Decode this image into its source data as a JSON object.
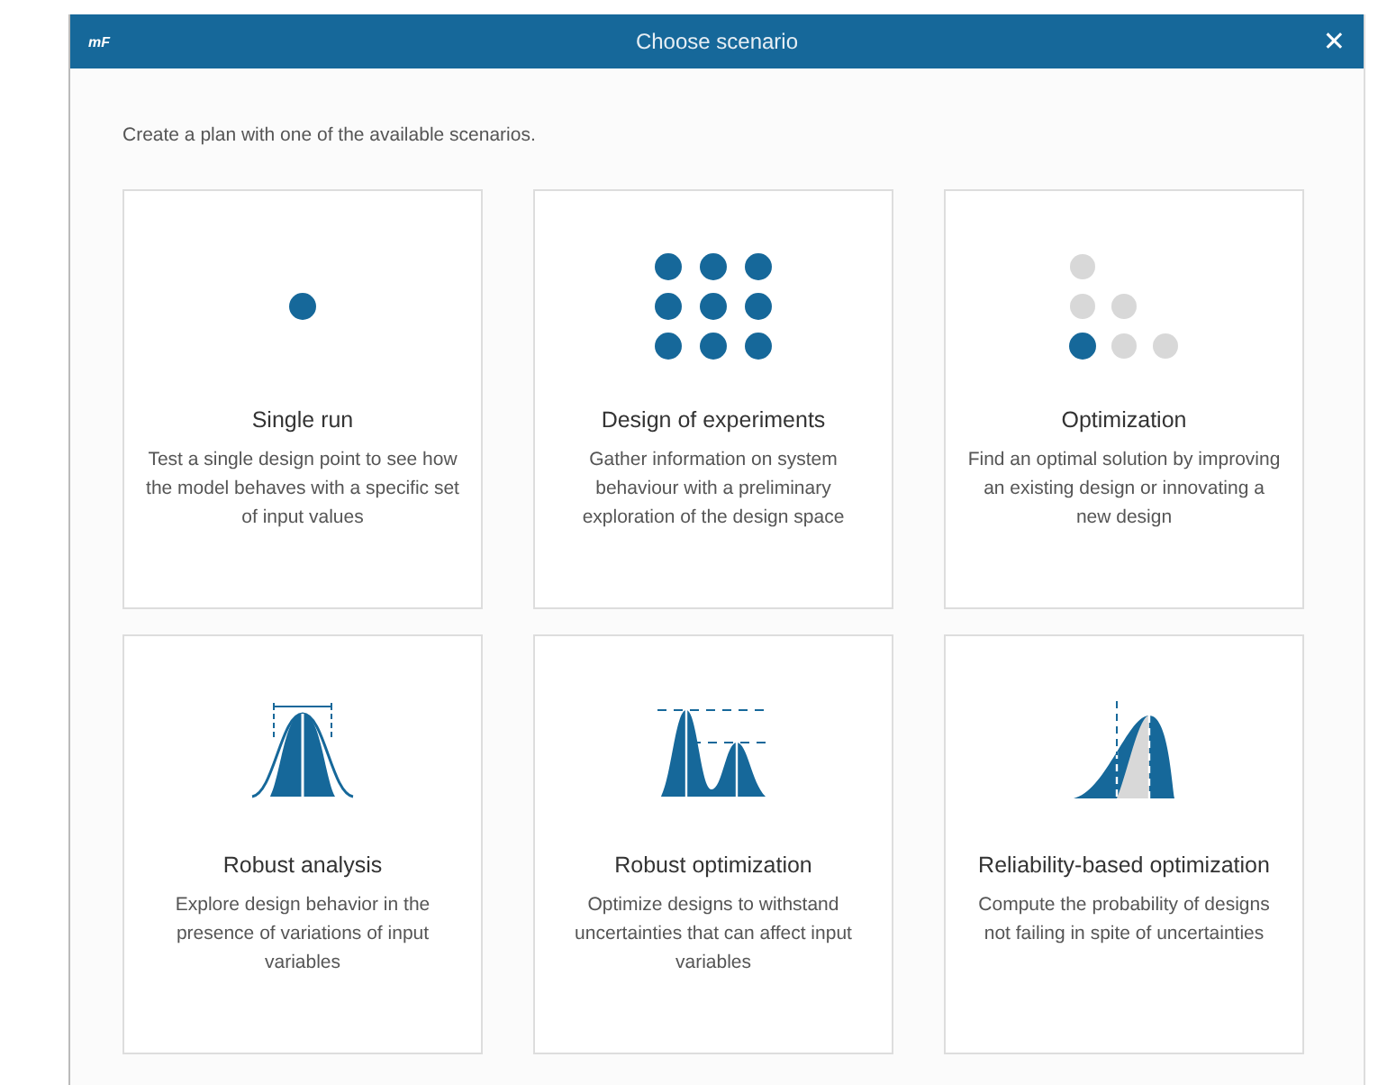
{
  "window": {
    "logo": "mF",
    "title": "Choose scenario",
    "close": "✕"
  },
  "intro": "Create a plan with one of the available scenarios.",
  "scenarios": [
    {
      "kind": "single",
      "title": "Single run",
      "description": "Test a single design point to see how the model behaves with a specific set of input values"
    },
    {
      "kind": "grid",
      "title": "Design of experiments",
      "description": "Gather information on system behaviour with a preliminary exploration of the design space"
    },
    {
      "kind": "optimization",
      "title": "Optimization",
      "description": "Find an optimal solution by improving an existing design or innovating a new design"
    },
    {
      "kind": "robust-analysis",
      "title": "Robust analysis",
      "description": "Explore design behavior in the presence of variations of input variables"
    },
    {
      "kind": "robust-optimization",
      "title": "Robust optimization",
      "description": "Optimize designs to withstand uncertainties that can affect input variables"
    },
    {
      "kind": "reliability",
      "title": "Reliability-based optimization",
      "description": "Compute the probability of designs not failing in spite of uncertainties"
    }
  ]
}
